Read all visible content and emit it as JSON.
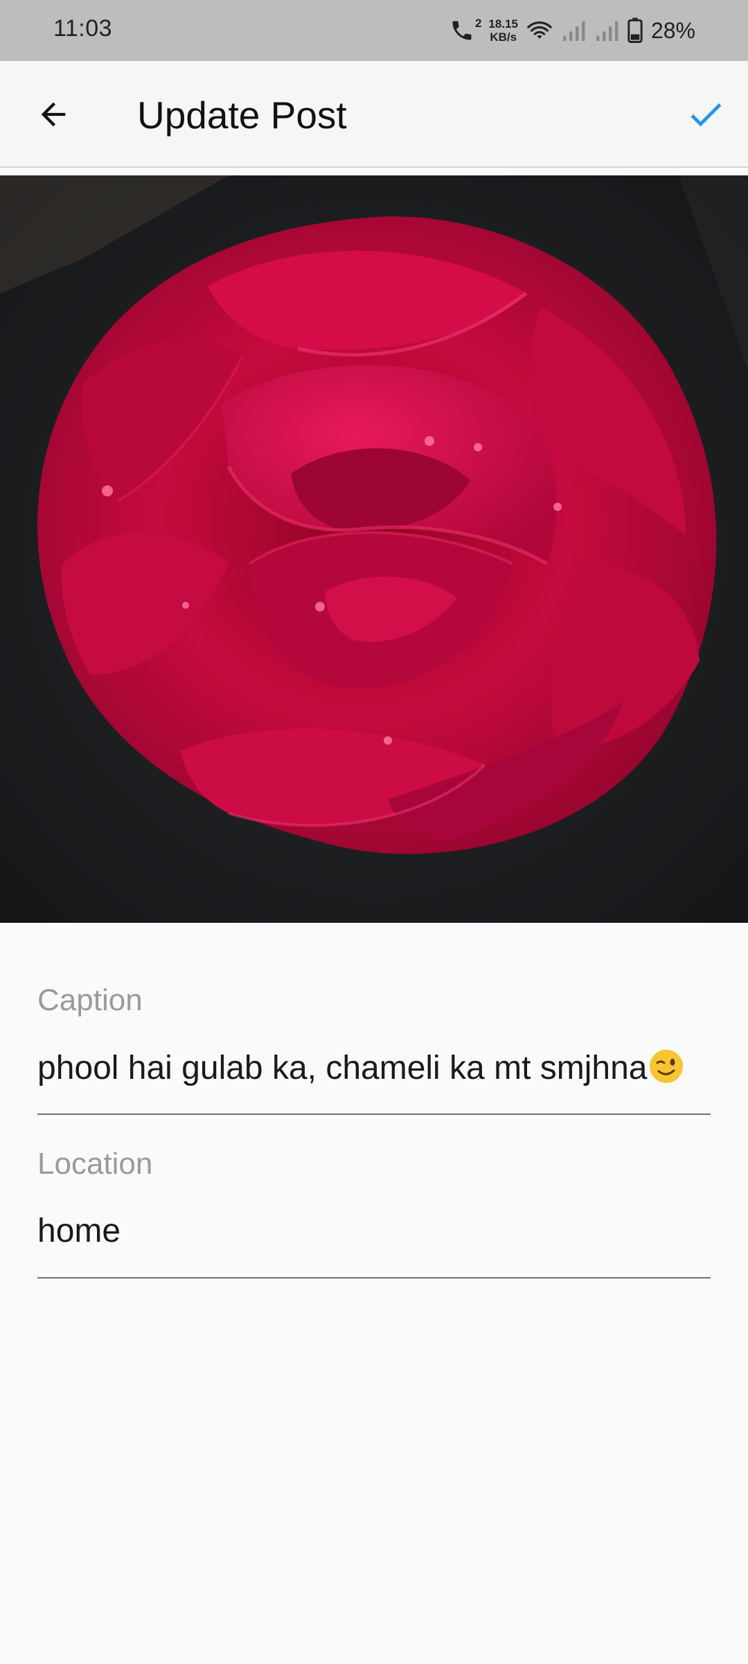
{
  "status_bar": {
    "time": "11:03",
    "call_indicator": "2",
    "net_speed_value": "18.15",
    "net_speed_unit": "KB/s",
    "battery": "28%"
  },
  "app_bar": {
    "title": "Update Post",
    "back_icon": "arrow-back-icon",
    "save_icon": "check-icon",
    "accent_color": "#2196f3"
  },
  "post_image": {
    "subject": "red rose"
  },
  "form": {
    "caption": {
      "label": "Caption",
      "value": "phool hai gulab ka, chameli ka mt smjhna",
      "emoji": "winking-face"
    },
    "location": {
      "label": "Location",
      "value": "home"
    }
  }
}
